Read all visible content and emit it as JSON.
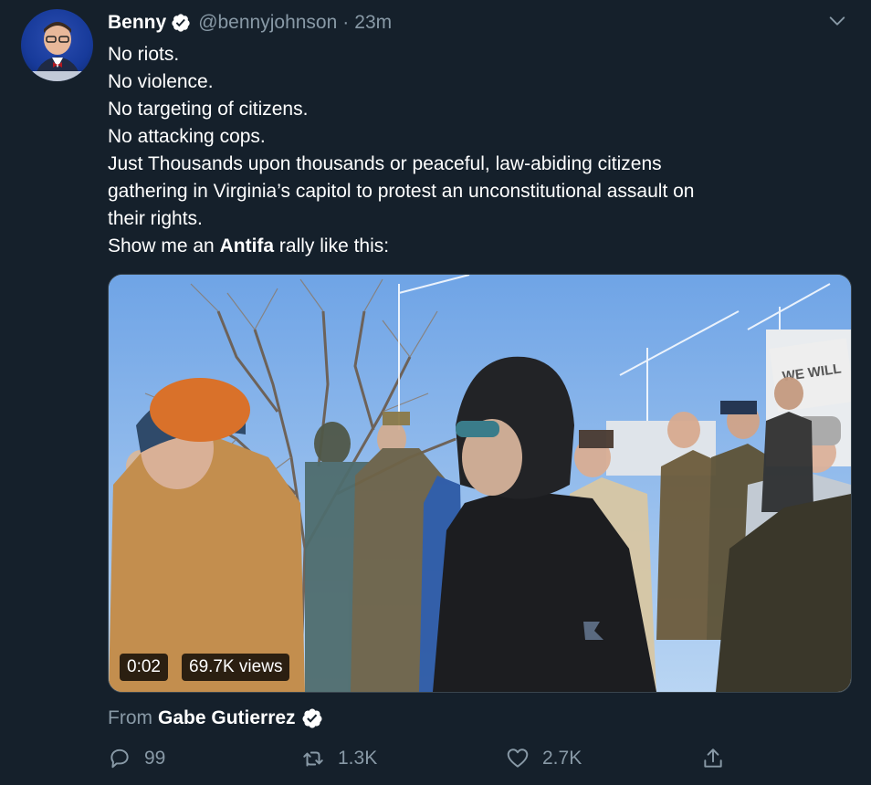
{
  "tweet": {
    "author_name": "Benny",
    "handle": "@bennyjohnson",
    "separator": "·",
    "time": "23m",
    "lines": [
      "No riots.",
      "No violence.",
      "No targeting of citizens.",
      "No attacking cops.",
      "Just Thousands upon thousands or peaceful, law-abiding citizens",
      "gathering in Virginia’s capitol to protest an unconstitutional assault on",
      "their rights."
    ],
    "last_line_prefix": "Show me an ",
    "last_line_bold": "Antifa",
    "last_line_suffix": " rally like this:"
  },
  "video": {
    "duration": "0:02",
    "views": "69.7K views",
    "sign_text": "WE WILL"
  },
  "attribution": {
    "label": "From",
    "author": "Gabe Gutierrez"
  },
  "actions": {
    "replies": "99",
    "retweets": "1.3K",
    "likes": "2.7K"
  },
  "colors": {
    "background": "#15202b",
    "secondary_text": "#8899a6",
    "verified": "#ffffff"
  }
}
